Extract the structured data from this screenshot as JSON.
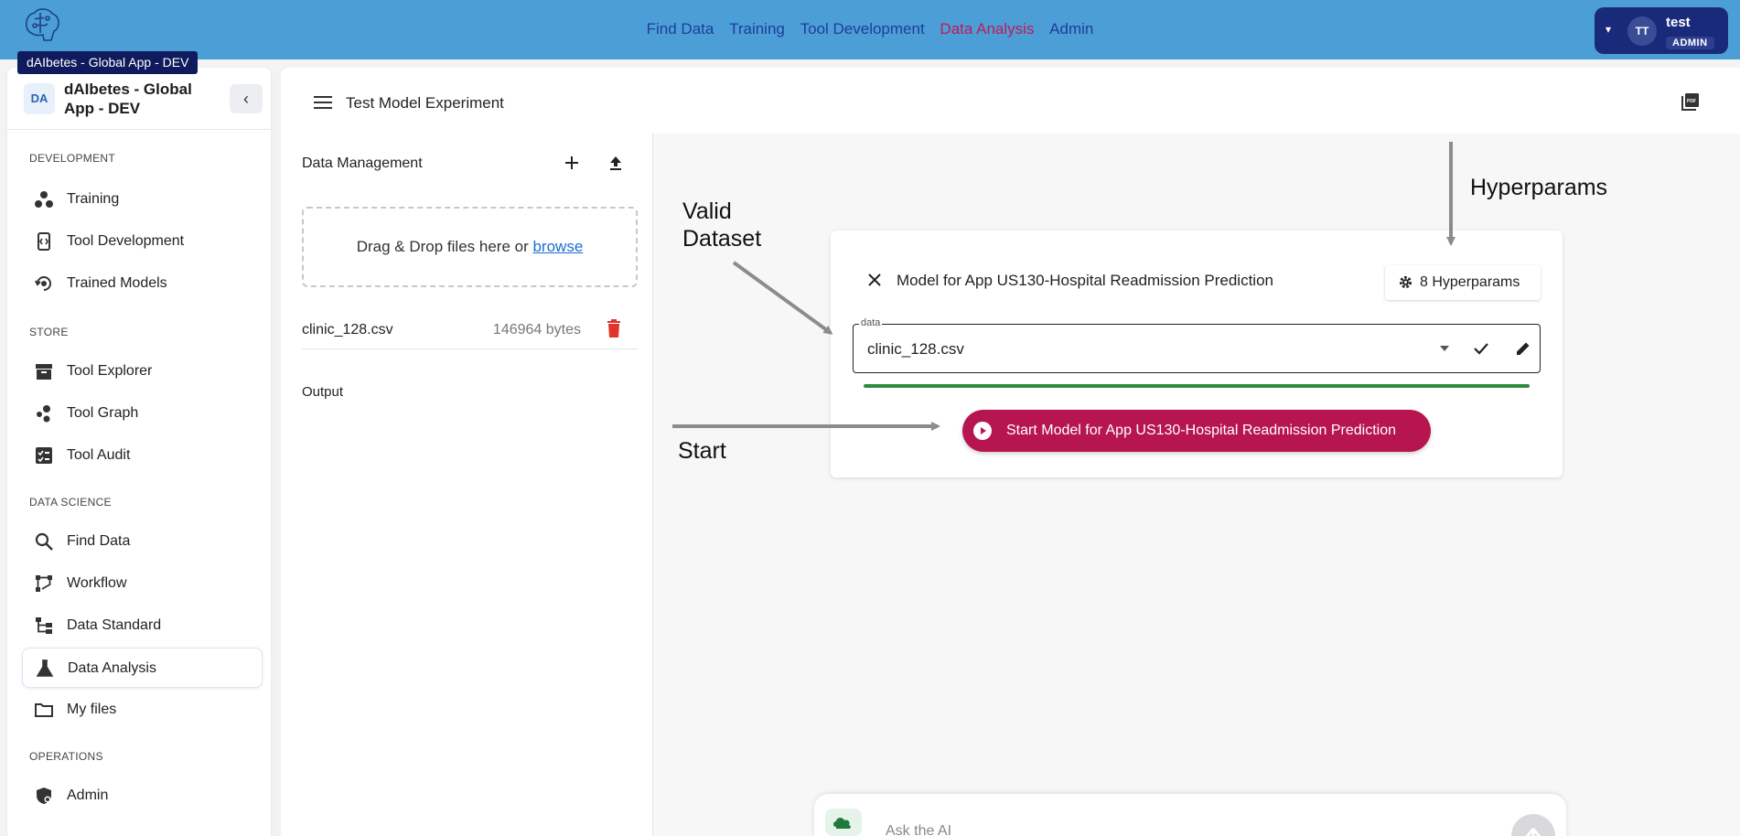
{
  "app": {
    "logo_tooltip": "dAIbetes - Global App - DEV",
    "logo_caption": "dAIbetes"
  },
  "topnav": {
    "items": [
      {
        "label": "Find Data",
        "active": false
      },
      {
        "label": "Training",
        "active": false
      },
      {
        "label": "Tool Development",
        "active": false
      },
      {
        "label": "Data Analysis",
        "active": true
      },
      {
        "label": "Admin",
        "active": false
      }
    ]
  },
  "user": {
    "initials": "TT",
    "name": "test",
    "role": "ADMIN"
  },
  "sidebar": {
    "badge": "DA",
    "title": "dAIbetes - Global App - DEV",
    "sections": [
      {
        "label": "DEVELOPMENT"
      },
      {
        "label": "STORE"
      },
      {
        "label": "DATA SCIENCE"
      },
      {
        "label": "OPERATIONS"
      }
    ],
    "items": [
      {
        "label": "Training",
        "icon": "training-icon"
      },
      {
        "label": "Tool Development",
        "icon": "tool-development-icon"
      },
      {
        "label": "Trained Models",
        "icon": "trained-models-icon"
      },
      {
        "label": "Tool Explorer",
        "icon": "archive-icon"
      },
      {
        "label": "Tool Graph",
        "icon": "graph-icon"
      },
      {
        "label": "Tool Audit",
        "icon": "audit-icon"
      },
      {
        "label": "Find Data",
        "icon": "search-icon"
      },
      {
        "label": "Workflow",
        "icon": "workflow-icon"
      },
      {
        "label": "Data Standard",
        "icon": "data-standard-icon"
      },
      {
        "label": "Data Analysis",
        "icon": "flask-icon",
        "active": true
      },
      {
        "label": "My files",
        "icon": "folder-icon"
      },
      {
        "label": "Admin",
        "icon": "shield-icon"
      }
    ]
  },
  "main": {
    "title": "Test Model Experiment",
    "data_management": {
      "title": "Data Management",
      "dropzone_text": "Drag & Drop files here or ",
      "dropzone_link": "browse",
      "files": [
        {
          "name": "clinic_128.csv",
          "size": "146964 bytes"
        }
      ],
      "output_label": "Output"
    },
    "model_card": {
      "title": "Model for App US130-Hospital Readmission Prediction",
      "hyperparams_label": "8 Hyperparams",
      "data_field_label": "data",
      "data_field_value": "clinic_128.csv",
      "start_label": "Start Model for App US130-Hospital Readmission Prediction",
      "valid_color": "#2e8b3d",
      "start_color": "#b7154f"
    },
    "annotations": {
      "valid_dataset": [
        "Valid",
        "Dataset"
      ],
      "hyperparams": "Hyperparams",
      "start": "Start"
    },
    "chat": {
      "placeholder": "Ask the AI"
    }
  },
  "colors": {
    "topbar": "#4b9fd6",
    "nav_link": "#1f3c9e",
    "nav_active": "#c0195a",
    "user_chip": "#1a2a7a"
  }
}
